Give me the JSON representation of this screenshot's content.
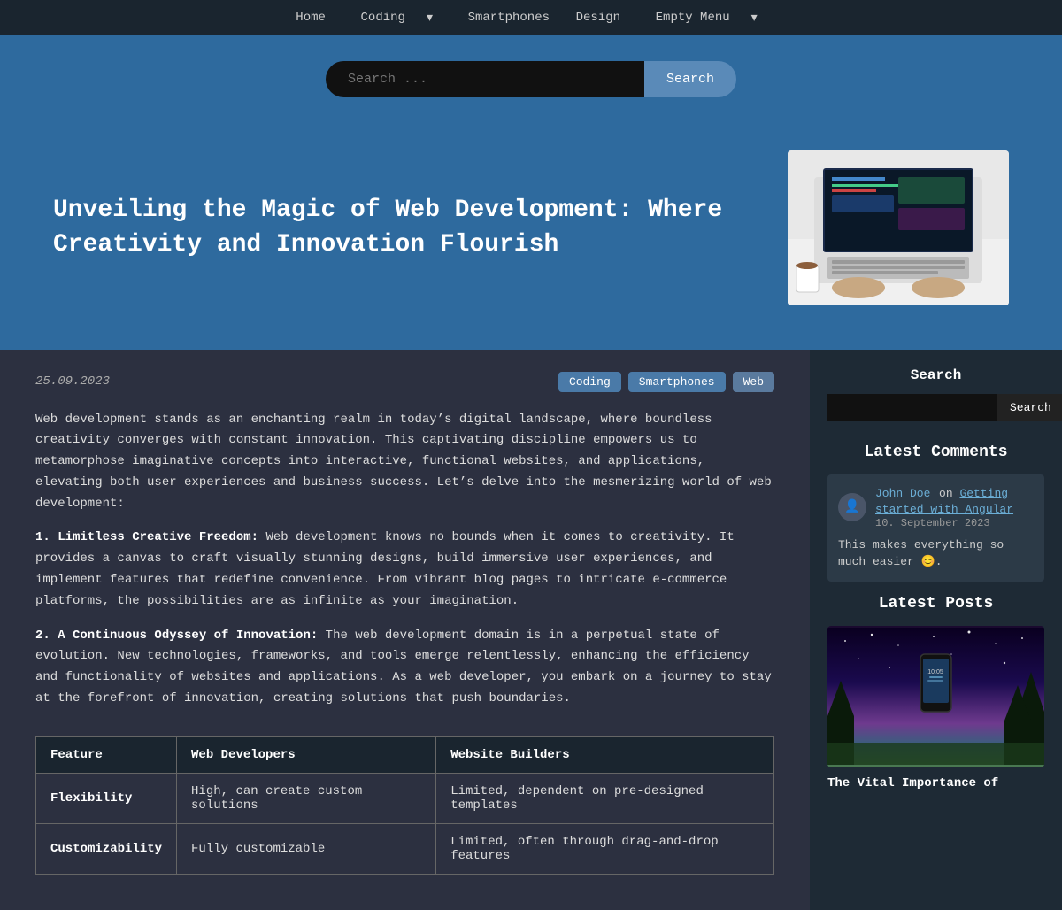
{
  "nav": {
    "items": [
      {
        "label": "Home",
        "href": "#"
      },
      {
        "label": "Coding",
        "href": "#",
        "hasDropdown": true
      },
      {
        "label": "Smartphones",
        "href": "#"
      },
      {
        "label": "Design",
        "href": "#"
      },
      {
        "label": "Empty Menu",
        "href": "#",
        "hasDropdown": true
      }
    ]
  },
  "search": {
    "placeholder": "Search ...",
    "button_label": "Search"
  },
  "hero": {
    "title": "Unveiling the Magic of Web Development: Where Creativity and Innovation Flourish"
  },
  "post": {
    "date": "25.09.2023",
    "tags": [
      "Coding",
      "Smartphones",
      "Web"
    ],
    "intro": "Web development stands as an enchanting realm in today’s digital landscape, where boundless creativity converges with constant innovation. This captivating discipline empowers us to metamorphose imaginative concepts into interactive, functional websites, and applications, elevating both user experiences and business success. Let’s delve into the mesmerizing world of web development:",
    "section1_title": "1. Limitless Creative Freedom:",
    "section1_text": "Web development knows no bounds when it comes to creativity. It provides a canvas to craft visually stunning designs, build immersive user experiences, and implement features that redefine convenience. From vibrant blog pages to intricate e-commerce platforms, the possibilities are as infinite as your imagination.",
    "section2_title": "2. A Continuous Odyssey of Innovation:",
    "section2_text": "The web development domain is in a perpetual state of evolution. New technologies, frameworks, and tools emerge relentlessly, enhancing the efficiency and functionality of websites and applications. As a web developer, you embark on a journey to stay at the forefront of innovation, creating solutions that push boundaries.",
    "table": {
      "headers": [
        "Feature",
        "Web Developers",
        "Website Builders"
      ],
      "rows": [
        [
          "Flexibility",
          "High, can create custom solutions",
          "Limited, dependent on pre-designed templates"
        ],
        [
          "Customizability",
          "Fully customizable",
          "Limited, often through drag-and-drop features"
        ]
      ]
    }
  },
  "sidebar": {
    "search_title": "Search",
    "search_placeholder": "",
    "search_button": "Search",
    "latest_comments_title": "Latest Comments",
    "comments": [
      {
        "author": "John Doe",
        "on_text": "on",
        "article_link": "Getting started with Angular",
        "date": "10. September 2023",
        "text": "This makes everything so much easier 😊.",
        "avatar": "👤"
      }
    ],
    "latest_posts_title": "Latest Posts",
    "latest_post_title": "The Vital Importance of"
  }
}
